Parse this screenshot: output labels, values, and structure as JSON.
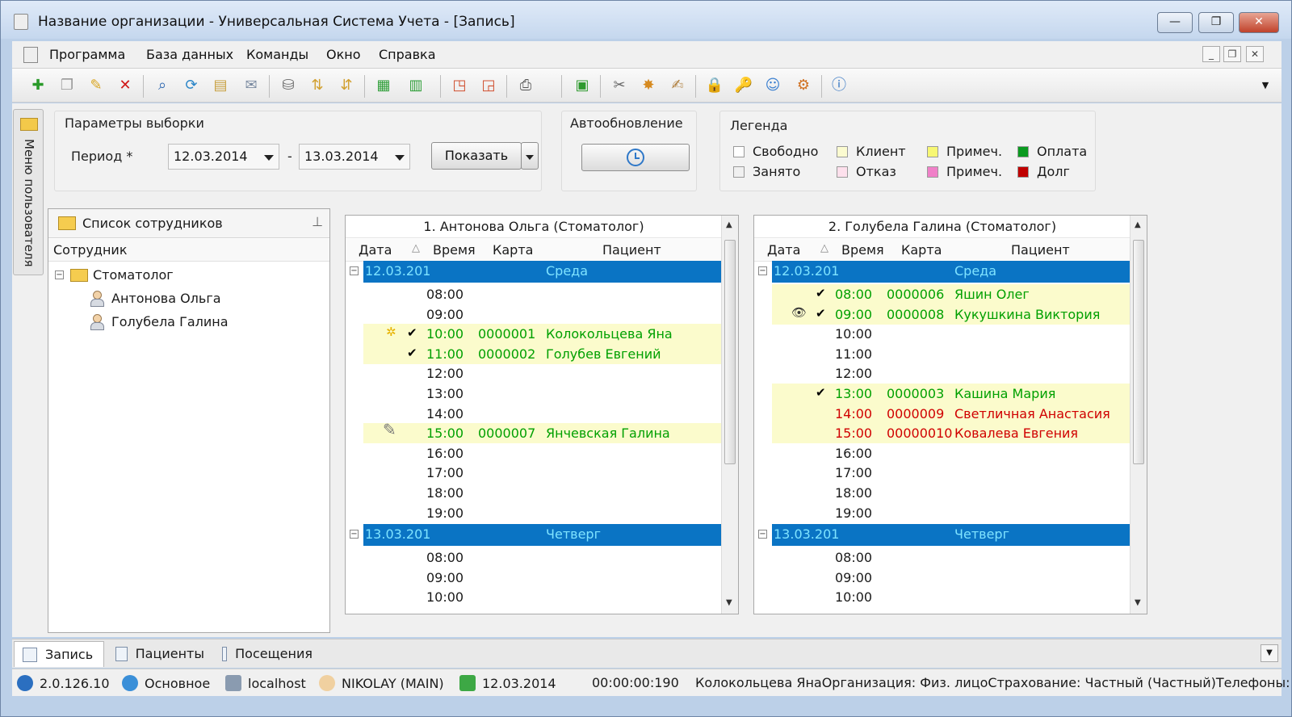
{
  "window": {
    "title": "Название организации - Универсальная Система Учета - [Запись]",
    "min_symbol": "—",
    "max_symbol": "❐",
    "close_symbol": "✕"
  },
  "menu": {
    "items": [
      "Программа",
      "База данных",
      "Команды",
      "Окно",
      "Справка"
    ],
    "mdi_min": "_",
    "mdi_restore": "❐",
    "mdi_close": "✕"
  },
  "side_tab": {
    "label": "Меню пользователя"
  },
  "params": {
    "group_label": "Параметры выборки",
    "period_label": "Период *",
    "date_from": "12.03.2014",
    "separator": "-",
    "date_to": "13.03.2014",
    "show_button": "Показать"
  },
  "autoupdate": {
    "label": "Автообновление"
  },
  "legend": {
    "label": "Легенда",
    "items": [
      {
        "label": "Свободно",
        "color": "#ffffff"
      },
      {
        "label": "Занято",
        "color": "#f0f0f0"
      },
      {
        "label": "Клиент",
        "color": "#fbfbd0"
      },
      {
        "label": "Отказ",
        "color": "#fde0ec"
      },
      {
        "label": "Примеч.",
        "color": "#f7f773"
      },
      {
        "label": "Примеч.",
        "color": "#f080c8"
      },
      {
        "label": "Оплата",
        "color": "#0b9a20"
      },
      {
        "label": "Долг",
        "color": "#c00000"
      }
    ]
  },
  "employees": {
    "title": "Список сотрудников",
    "column": "Сотрудник",
    "group": "Стоматолог",
    "items": [
      "Антонова Ольга",
      "Голубела Галина"
    ]
  },
  "schedule_headers": {
    "date": "Дата",
    "time": "Время",
    "card": "Карта",
    "patient": "Пациент"
  },
  "schedules": [
    {
      "title": "1. Антонова Ольга (Стоматолог)",
      "days": [
        {
          "date": "12.03.201",
          "weekday": "Среда",
          "slots": [
            {
              "time": "08:00"
            },
            {
              "time": "09:00"
            },
            {
              "time": "10:00",
              "card": "0000001",
              "patient": "Колокольцева Яна",
              "status": "green",
              "check": "✔",
              "icon": "✲"
            },
            {
              "time": "11:00",
              "card": "0000002",
              "patient": "Голубев Евгений",
              "status": "green",
              "check": "✔"
            },
            {
              "time": "12:00"
            },
            {
              "time": "13:00"
            },
            {
              "time": "14:00"
            },
            {
              "time": "15:00",
              "card": "0000007",
              "patient": "Янчевская Галина",
              "status": "green",
              "icon": "✎"
            },
            {
              "time": "16:00"
            },
            {
              "time": "17:00"
            },
            {
              "time": "18:00"
            },
            {
              "time": "19:00"
            }
          ]
        },
        {
          "date": "13.03.201",
          "weekday": "Четверг",
          "slots": [
            {
              "time": "08:00"
            },
            {
              "time": "09:00"
            },
            {
              "time": "10:00"
            }
          ]
        }
      ]
    },
    {
      "title": "2. Голубела Галина (Стоматолог)",
      "days": [
        {
          "date": "12.03.201",
          "weekday": "Среда",
          "slots": [
            {
              "time": "08:00",
              "card": "0000006",
              "patient": "Яшин Олег",
              "status": "green",
              "check": "✔"
            },
            {
              "time": "09:00",
              "card": "0000008",
              "patient": "Кукушкина Виктория",
              "status": "green",
              "check": "✔",
              "icon": "👁"
            },
            {
              "time": "10:00"
            },
            {
              "time": "11:00"
            },
            {
              "time": "12:00"
            },
            {
              "time": "13:00",
              "card": "0000003",
              "patient": "Кашина Мария",
              "status": "green",
              "check": "✔"
            },
            {
              "time": "14:00",
              "card": "0000009",
              "patient": "Светличная Анастасия",
              "status": "red"
            },
            {
              "time": "15:00",
              "card": "00000010",
              "patient": "Ковалева Евгения",
              "status": "red"
            },
            {
              "time": "16:00"
            },
            {
              "time": "17:00"
            },
            {
              "time": "18:00"
            },
            {
              "time": "19:00"
            }
          ]
        },
        {
          "date": "13.03.201",
          "weekday": "Четверг",
          "slots": [
            {
              "time": "08:00"
            },
            {
              "time": "09:00"
            },
            {
              "time": "10:00"
            }
          ]
        }
      ]
    }
  ],
  "tabs": [
    {
      "label": "Запись"
    },
    {
      "label": "Пациенты"
    },
    {
      "label": "Посещения"
    }
  ],
  "status": {
    "version": "2.0.126.10",
    "database": "Основное",
    "server": "localhost",
    "user": "NIKOLAY (MAIN)",
    "date": "12.03.2014",
    "timer": "00:00:00:190",
    "info": "Колокольцева ЯнаОрганизация: Физ. лицоСтрахование: Частный (Частный)Телефоны:"
  }
}
